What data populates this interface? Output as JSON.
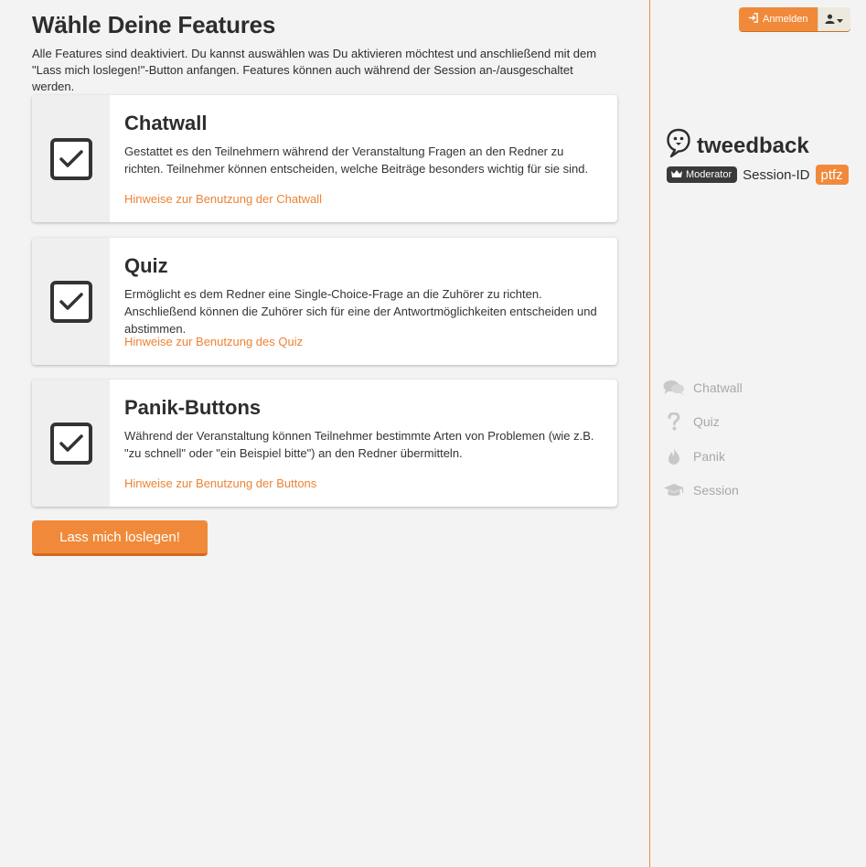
{
  "main": {
    "title": "Wähle Deine Features",
    "intro": "Alle Features sind deaktiviert. Du kannst auswählen was Du aktivieren möchtest und anschließend mit dem \"Lass mich loslegen!\"-Button anfangen. Features können auch während der Session an-/ausgeschaltet werden.",
    "features": [
      {
        "title": "Chatwall",
        "description": "Gestattet es den Teilnehmern während der Veranstaltung Fragen an den Redner zu richten. Teilnehmer können entscheiden, welche Beiträge besonders wichtig für sie sind.",
        "link": "Hinweise zur Benutzung der Chatwall",
        "checked": true
      },
      {
        "title": "Quiz",
        "description": "Ermöglicht es dem Redner eine Single-Choice-Frage an die Zuhörer zu richten. Anschließend können die Zuhörer sich für eine der Antwortmöglichkeiten entscheiden und abstimmen.",
        "link": "Hinweise zur Benutzung des Quiz",
        "checked": true
      },
      {
        "title": "Panik-Buttons",
        "description": "Während der Veranstaltung können Teilnehmer bestimmte Arten von Problemen (wie z.B. \"zu schnell\" oder \"ein Beispiel bitte\") an den Redner übermitteln.",
        "link": "Hinweise zur Benutzung der Buttons",
        "checked": true
      }
    ],
    "start_button": "Lass mich loslegen!"
  },
  "header": {
    "login_label": "Anmelden",
    "login_icon": "sign-in-icon",
    "user_icon": "user-icon"
  },
  "sidebar": {
    "brand_name": "tweedback",
    "role_badge": "Moderator",
    "session_label": "Session-ID",
    "session_id": "ptfz",
    "nav": [
      {
        "label": "Chatwall",
        "icon": "chat-bubbles-icon"
      },
      {
        "label": "Quiz",
        "icon": "question-icon"
      },
      {
        "label": "Panik",
        "icon": "flame-icon"
      },
      {
        "label": "Session",
        "icon": "graduation-cap-icon"
      }
    ]
  },
  "colors": {
    "accent": "#f08a3a",
    "link": "#ee8233",
    "nav_inactive": "#a8a8a8",
    "badge_dark": "#3a3a3a"
  }
}
